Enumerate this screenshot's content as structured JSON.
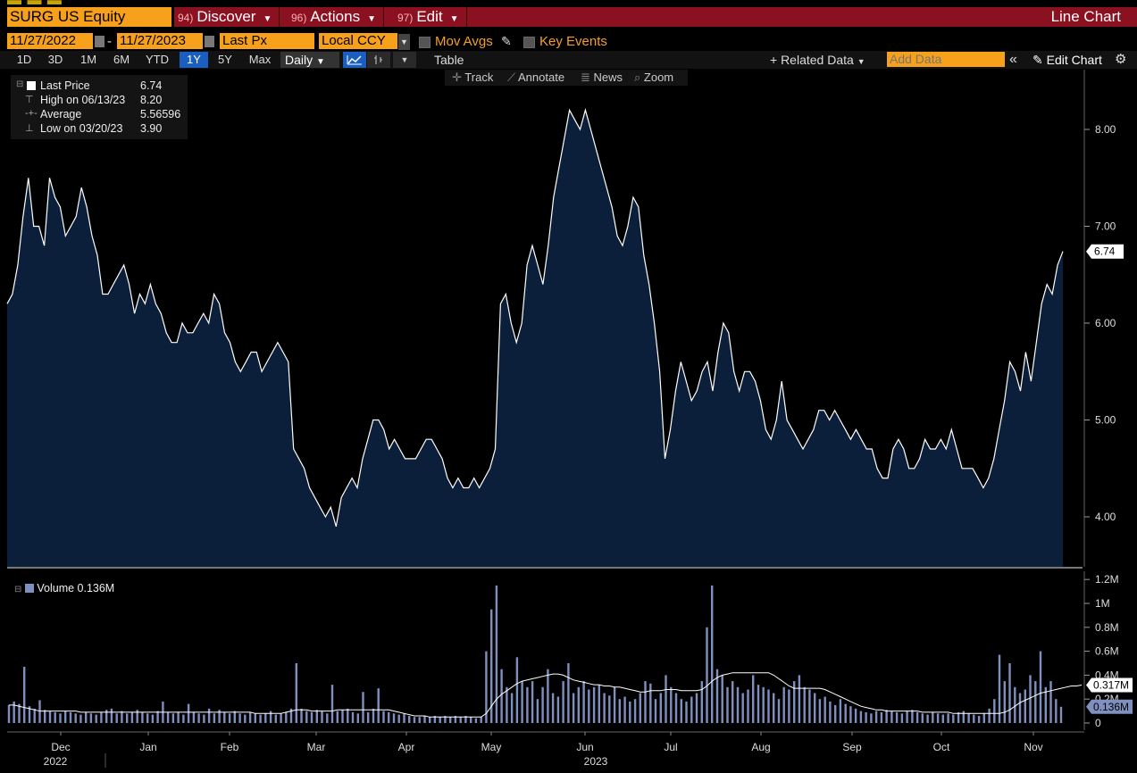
{
  "ticker": "SURG US Equity",
  "menus": [
    {
      "num": "94)",
      "label": "Discover"
    },
    {
      "num": "96)",
      "label": "Actions"
    },
    {
      "num": "97)",
      "label": "Edit"
    }
  ],
  "chart_title": "Line Chart",
  "controls": {
    "start_date": "11/27/2022",
    "end_date": "11/27/2023",
    "field": "Last Px",
    "currency": "Local CCY",
    "mov_avgs": "Mov Avgs",
    "key_events": "Key Events"
  },
  "periods": [
    "1D",
    "3D",
    "1M",
    "6M",
    "YTD",
    "1Y",
    "5Y",
    "Max"
  ],
  "selected_period": "1Y",
  "frequency": "Daily",
  "table_label": "Table",
  "related_label": "+ Related Data",
  "add_data_placeholder": "Add Data",
  "edit_chart_label": "Edit Chart",
  "tools": [
    "Track",
    "Annotate",
    "News",
    "Zoom"
  ],
  "legend": {
    "last_label": "Last Price",
    "last_value": "6.74",
    "high_label": "High on 06/13/23",
    "high_value": "8.20",
    "avg_label": "Average",
    "avg_value": "5.56596",
    "low_label": "Low on 03/20/23",
    "low_value": "3.90"
  },
  "volume_legend": "Volume 0.136M",
  "colors": {
    "accent": "#f7a01c",
    "menubar": "#8b1020",
    "area_fill": "#0b1f3a",
    "volume_bar": "#7f8fbf"
  },
  "chart_data": [
    {
      "type": "area",
      "series": [
        {
          "name": "Last Price"
        }
      ],
      "ylim": [
        3.5,
        8.5
      ],
      "yticks": [
        "8.00",
        "7.00",
        "6.00",
        "5.00",
        "4.00"
      ],
      "last_value_tag": "6.74",
      "x_months": [
        "Dec",
        "Jan",
        "Feb",
        "Mar",
        "Apr",
        "May",
        "Jun",
        "Jul",
        "Aug",
        "Sep",
        "Oct",
        "Nov"
      ],
      "x_years": [
        "2022",
        "2023"
      ],
      "values": [
        6.2,
        6.3,
        6.6,
        7.1,
        7.5,
        7.0,
        7.0,
        6.8,
        7.5,
        7.3,
        7.2,
        6.9,
        7.0,
        7.1,
        7.4,
        7.2,
        6.9,
        6.7,
        6.3,
        6.3,
        6.4,
        6.5,
        6.6,
        6.4,
        6.1,
        6.3,
        6.2,
        6.4,
        6.2,
        6.1,
        5.9,
        5.8,
        5.8,
        6.0,
        5.9,
        5.9,
        6.0,
        6.1,
        6.0,
        6.3,
        6.2,
        5.9,
        5.8,
        5.6,
        5.5,
        5.6,
        5.7,
        5.7,
        5.5,
        5.6,
        5.7,
        5.8,
        5.7,
        5.6,
        4.7,
        4.6,
        4.5,
        4.3,
        4.2,
        4.1,
        4.0,
        4.1,
        3.9,
        4.2,
        4.3,
        4.4,
        4.3,
        4.6,
        4.8,
        5.0,
        5.0,
        4.9,
        4.7,
        4.8,
        4.7,
        4.6,
        4.6,
        4.6,
        4.7,
        4.8,
        4.8,
        4.7,
        4.6,
        4.4,
        4.3,
        4.4,
        4.3,
        4.3,
        4.4,
        4.3,
        4.4,
        4.5,
        4.7,
        6.2,
        6.3,
        6.0,
        5.8,
        6.0,
        6.6,
        6.8,
        6.6,
        6.4,
        6.8,
        7.3,
        7.6,
        7.9,
        8.2,
        8.1,
        8.0,
        8.2,
        8.0,
        7.8,
        7.6,
        7.4,
        7.2,
        6.9,
        6.8,
        7.0,
        7.3,
        7.2,
        6.7,
        6.4,
        6.0,
        5.5,
        4.6,
        4.9,
        5.3,
        5.6,
        5.4,
        5.2,
        5.3,
        5.5,
        5.6,
        5.3,
        5.7,
        6.0,
        5.9,
        5.5,
        5.3,
        5.5,
        5.5,
        5.4,
        5.2,
        4.9,
        4.8,
        5.0,
        5.4,
        5.0,
        4.9,
        4.8,
        4.7,
        4.8,
        4.9,
        5.1,
        5.1,
        5.0,
        5.1,
        5.0,
        4.9,
        4.8,
        4.9,
        4.8,
        4.7,
        4.7,
        4.5,
        4.4,
        4.4,
        4.7,
        4.8,
        4.7,
        4.5,
        4.5,
        4.6,
        4.8,
        4.7,
        4.7,
        4.8,
        4.7,
        4.9,
        4.7,
        4.5,
        4.5,
        4.5,
        4.4,
        4.3,
        4.4,
        4.6,
        4.9,
        5.2,
        5.6,
        5.5,
        5.3,
        5.7,
        5.4,
        5.8,
        6.2,
        6.4,
        6.3,
        6.6,
        6.74
      ]
    },
    {
      "type": "bar",
      "series": [
        {
          "name": "Volume"
        }
      ],
      "ylim": [
        0,
        1.3
      ],
      "yticks": [
        "1.2M",
        "1M",
        "0.8M",
        "0.6M",
        "0.4M",
        "0.2M",
        "0"
      ],
      "last_value_tags": [
        "0.317M",
        "0.136M"
      ],
      "values": [
        0.15,
        0.18,
        0.16,
        0.47,
        0.14,
        0.12,
        0.19,
        0.11,
        0.1,
        0.09,
        0.08,
        0.1,
        0.09,
        0.08,
        0.07,
        0.09,
        0.08,
        0.07,
        0.09,
        0.11,
        0.12,
        0.08,
        0.1,
        0.08,
        0.09,
        0.11,
        0.09,
        0.08,
        0.07,
        0.1,
        0.18,
        0.09,
        0.08,
        0.09,
        0.07,
        0.16,
        0.09,
        0.08,
        0.07,
        0.12,
        0.08,
        0.11,
        0.09,
        0.08,
        0.1,
        0.08,
        0.07,
        0.09,
        0.08,
        0.07,
        0.08,
        0.1,
        0.07,
        0.08,
        0.09,
        0.12,
        0.5,
        0.12,
        0.1,
        0.09,
        0.11,
        0.1,
        0.08,
        0.32,
        0.1,
        0.11,
        0.12,
        0.09,
        0.08,
        0.26,
        0.09,
        0.12,
        0.29,
        0.1,
        0.09,
        0.08,
        0.07,
        0.08,
        0.06,
        0.05,
        0.05,
        0.06,
        0.05,
        0.06,
        0.05,
        0.06,
        0.05,
        0.06,
        0.05,
        0.06,
        0.05,
        0.04,
        0.05,
        0.6,
        0.95,
        1.15,
        0.45,
        0.3,
        0.25,
        0.55,
        0.35,
        0.3,
        0.35,
        0.2,
        0.3,
        0.45,
        0.25,
        0.22,
        0.35,
        0.5,
        0.25,
        0.3,
        0.35,
        0.28,
        0.3,
        0.32,
        0.25,
        0.23,
        0.3,
        0.2,
        0.22,
        0.18,
        0.2,
        0.25,
        0.35,
        0.33,
        0.2,
        0.25,
        0.4,
        0.3,
        0.25,
        0.2,
        0.18,
        0.22,
        0.25,
        0.35,
        0.8,
        1.15,
        0.45,
        0.4,
        0.3,
        0.35,
        0.3,
        0.25,
        0.28,
        0.4,
        0.32,
        0.3,
        0.28,
        0.25,
        0.2,
        0.3,
        0.28,
        0.35,
        0.4,
        0.3,
        0.28,
        0.25,
        0.2,
        0.22,
        0.18,
        0.15,
        0.2,
        0.16,
        0.14,
        0.12,
        0.1,
        0.09,
        0.08,
        0.1,
        0.09,
        0.11,
        0.1,
        0.09,
        0.08,
        0.1,
        0.11,
        0.09,
        0.08,
        0.07,
        0.09,
        0.08,
        0.07,
        0.08,
        0.07,
        0.09,
        0.1,
        0.08,
        0.07,
        0.06,
        0.08,
        0.12,
        0.2,
        0.57,
        0.35,
        0.5,
        0.3,
        0.25,
        0.28,
        0.4,
        0.35,
        0.6,
        0.3,
        0.35,
        0.2,
        0.136
      ],
      "moving_average": [
        0.15,
        0.15,
        0.14,
        0.13,
        0.12,
        0.11,
        0.1,
        0.1,
        0.1,
        0.1,
        0.1,
        0.1,
        0.1,
        0.1,
        0.09,
        0.09,
        0.09,
        0.09,
        0.09,
        0.09,
        0.09,
        0.09,
        0.09,
        0.09,
        0.09,
        0.09,
        0.09,
        0.09,
        0.09,
        0.09,
        0.09,
        0.09,
        0.09,
        0.09,
        0.09,
        0.09,
        0.09,
        0.09,
        0.09,
        0.09,
        0.09,
        0.09,
        0.09,
        0.09,
        0.09,
        0.09,
        0.09,
        0.09,
        0.08,
        0.08,
        0.08,
        0.08,
        0.08,
        0.08,
        0.09,
        0.1,
        0.11,
        0.11,
        0.11,
        0.1,
        0.1,
        0.1,
        0.1,
        0.1,
        0.11,
        0.11,
        0.11,
        0.11,
        0.11,
        0.11,
        0.11,
        0.11,
        0.11,
        0.11,
        0.11,
        0.1,
        0.09,
        0.08,
        0.07,
        0.06,
        0.06,
        0.06,
        0.05,
        0.05,
        0.05,
        0.05,
        0.05,
        0.05,
        0.05,
        0.05,
        0.05,
        0.05,
        0.05,
        0.08,
        0.14,
        0.2,
        0.24,
        0.27,
        0.3,
        0.33,
        0.35,
        0.36,
        0.37,
        0.38,
        0.39,
        0.4,
        0.41,
        0.41,
        0.4,
        0.38,
        0.36,
        0.35,
        0.34,
        0.33,
        0.32,
        0.32,
        0.31,
        0.31,
        0.3,
        0.3,
        0.29,
        0.28,
        0.27,
        0.26,
        0.26,
        0.27,
        0.27,
        0.27,
        0.28,
        0.28,
        0.28,
        0.27,
        0.27,
        0.27,
        0.27,
        0.28,
        0.31,
        0.35,
        0.38,
        0.4,
        0.41,
        0.42,
        0.42,
        0.42,
        0.42,
        0.42,
        0.42,
        0.42,
        0.42,
        0.4,
        0.37,
        0.34,
        0.31,
        0.29,
        0.29,
        0.29,
        0.29,
        0.29,
        0.29,
        0.28,
        0.26,
        0.24,
        0.22,
        0.2,
        0.18,
        0.16,
        0.14,
        0.13,
        0.12,
        0.11,
        0.11,
        0.1,
        0.1,
        0.1,
        0.1,
        0.1,
        0.1,
        0.1,
        0.09,
        0.09,
        0.09,
        0.09,
        0.09,
        0.09,
        0.08,
        0.08,
        0.08,
        0.08,
        0.08,
        0.08,
        0.08,
        0.08,
        0.08,
        0.08,
        0.09,
        0.11,
        0.14,
        0.17,
        0.19,
        0.21,
        0.23,
        0.25,
        0.26,
        0.27,
        0.28,
        0.29,
        0.3,
        0.31,
        0.31,
        0.317
      ]
    }
  ]
}
